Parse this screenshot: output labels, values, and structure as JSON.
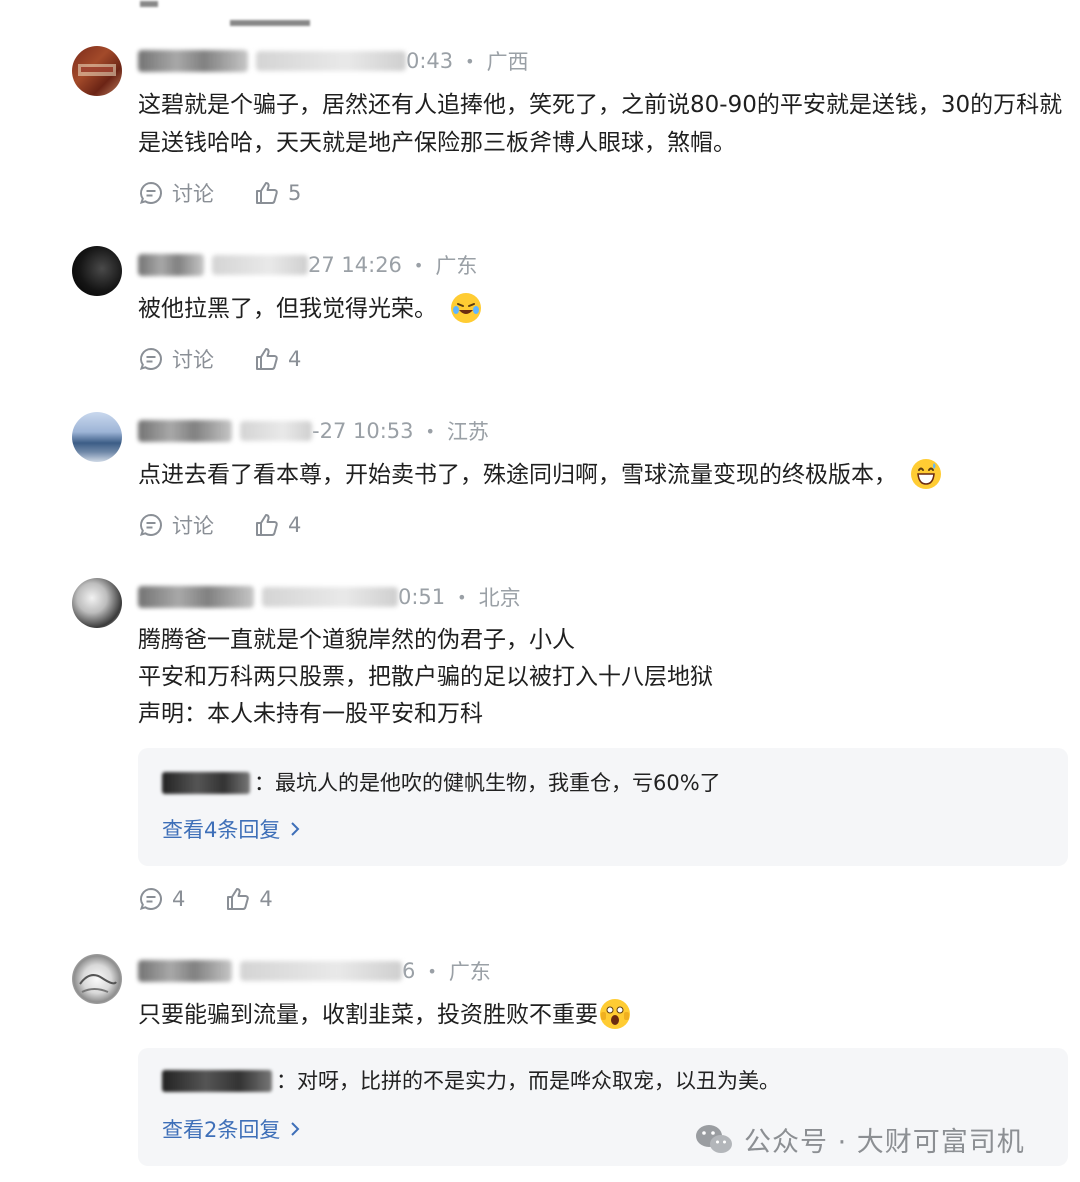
{
  "comments": [
    {
      "time_tail": "0:43",
      "location": "广西",
      "lines": [
        "这碧就是个骗子，居然还有人追捧他，笑死了，之前说80-90的平安就是送钱，30的万科就",
        "是送钱哈哈，天天就是地产保险那三板斧博人眼球，煞帽。"
      ],
      "discuss_label": "讨论",
      "likes": "5"
    },
    {
      "time_tail": "27 14:26",
      "location": "广东",
      "lines": [
        "被他拉黑了，但我觉得光荣。"
      ],
      "emoji": "laughing-tears-emoji",
      "discuss_label": "讨论",
      "likes": "4"
    },
    {
      "time_tail": "-27 10:53",
      "location": "江苏",
      "lines": [
        "点进去看了看本尊，开始卖书了，殊途同归啊，雪球流量变现的终极版本，"
      ],
      "emoji": "grinning-sweat-emoji",
      "discuss_label": "讨论",
      "likes": "4"
    },
    {
      "time_tail": "0:51",
      "location": "北京",
      "lines": [
        "腾腾爸一直就是个道貌岸然的伪君子，小人",
        "平安和万科两只股票，把散户骗的足以被打入十八层地狱",
        "声明：本人未持有一股平安和万科"
      ],
      "reply_text": "：最坑人的是他吹的健帆生物，我重仓，亏60%了",
      "reply_more": "查看4条回复",
      "discuss_count": "4",
      "likes": "4"
    },
    {
      "time_tail": "6",
      "location": "广东",
      "lines": [
        "只要能骗到流量，收割韭菜，投资胜败不重要"
      ],
      "emoji": "shocked-emoji",
      "reply_text": "：对呀，比拼的不是实力，而是哗众取宠，以丑为美。",
      "reply_more": "查看2条回复"
    }
  ],
  "watermark": "公众号 · 大财可富司机",
  "colors": {
    "link": "#3e6fb8",
    "meta": "#9aa0a6",
    "reply_bg": "#f5f6f8"
  }
}
